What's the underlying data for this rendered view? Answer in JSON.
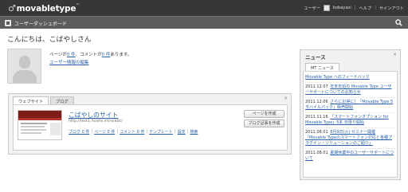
{
  "app": {
    "logo": "movabletype",
    "logo_tm": "™"
  },
  "user_menu": {
    "user_label": "ユーザー",
    "username": "kobayasi",
    "help": "ヘルプ",
    "signout": "サインアウト"
  },
  "subheader": {
    "title": "ユーザーダッシュボード"
  },
  "greeting": "こんにちは、こばやしさん",
  "stats": {
    "pages_prefix": "ページが",
    "pages_count": "0 件",
    "comments_prefix": "、コメントが",
    "comments_count": "0 件",
    "suffix": "あります。"
  },
  "edit_profile": "ユーザー情報の編集",
  "sites_widget": {
    "tabs": [
      "ウェブサイト",
      "ブログ"
    ],
    "close": "×",
    "site_name": "こばやしのサイト",
    "site_url": "http://test1.husite.intra/abc/",
    "links": [
      "ブログ 0 件",
      "ページ 0 件",
      "コメント 0 件",
      "テンプレート",
      "設定",
      "検索"
    ],
    "create_page": "ページを作成",
    "create_entry": "ブログ記事を作成"
  },
  "news_widget": {
    "title": "ニュース",
    "close": "×",
    "tab": "MT ニュース",
    "items": [
      {
        "date": "",
        "text": "Movable Type へのフィードバック"
      },
      {
        "date": "2011.12.07",
        "text": "年末年始の Movable Type ユーザーサポートについてのお知らせ"
      },
      {
        "date": "2011.12.06",
        "text": "さらにお得に！「Movable Type 5 モバイルパック」販売開始"
      },
      {
        "date": "2011.11.16",
        "text": "「スマートフォンオプション for Movable Type」5本 日限り開始"
      },
      {
        "date": "2011.08.01",
        "text": "8月9日(火) セミナー開催「Movable Typeのスマートフォン対応と各種プラグイン・ソリューションのご紹介」"
      },
      {
        "date": "2011.08.01",
        "text": "夏期休業中のユーザーサポートについて"
      }
    ]
  }
}
